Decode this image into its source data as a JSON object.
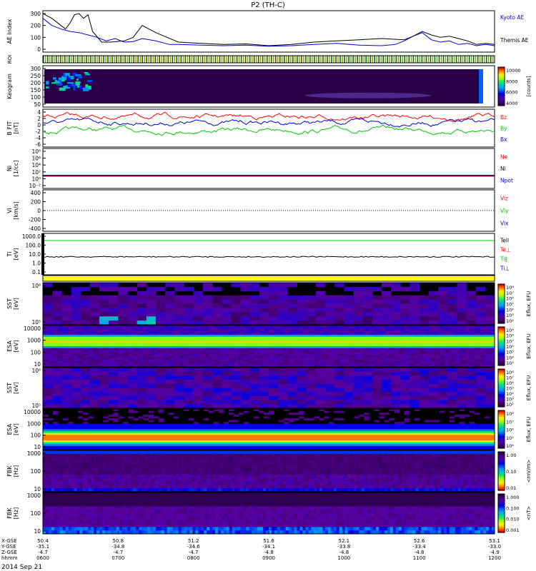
{
  "title": "P2 (TH-C)",
  "date_label": "2014 Sep 21",
  "colors": {
    "red": "#ff0000",
    "green": "#00c800",
    "blue": "#0000dc",
    "black": "#000000",
    "yellow": "#ffff00"
  },
  "chart_data": [
    {
      "type": "line",
      "panel": "ae",
      "ylabel": "AE Index",
      "ylim": [
        0,
        300
      ],
      "yticks": [
        "0",
        "100",
        "200",
        "300"
      ],
      "legend": [
        "Kyoto AE",
        "Themis AE"
      ],
      "series": [
        {
          "name": "Kyoto AE",
          "color": "#0000dc",
          "x": [
            0,
            0.02,
            0.04,
            0.06,
            0.08,
            0.1,
            0.12,
            0.14,
            0.16,
            0.18,
            0.2,
            0.22,
            0.25,
            0.28,
            0.3,
            0.35,
            0.4,
            0.45,
            0.5,
            0.55,
            0.6,
            0.65,
            0.7,
            0.75,
            0.78,
            0.8,
            0.82,
            0.84,
            0.86,
            0.88,
            0.9,
            0.92,
            0.94,
            0.96,
            0.98,
            1
          ],
          "y": [
            260,
            200,
            170,
            150,
            140,
            120,
            100,
            70,
            90,
            60,
            65,
            90,
            70,
            40,
            40,
            35,
            30,
            35,
            25,
            30,
            40,
            50,
            35,
            30,
            40,
            70,
            110,
            140,
            80,
            60,
            70,
            40,
            50,
            30,
            40,
            30
          ]
        },
        {
          "name": "Themis AE",
          "color": "#000000",
          "x": [
            0,
            0.01,
            0.02,
            0.04,
            0.05,
            0.06,
            0.07,
            0.08,
            0.09,
            0.1,
            0.11,
            0.13,
            0.15,
            0.18,
            0.2,
            0.22,
            0.25,
            0.3,
            0.35,
            0.4,
            0.45,
            0.5,
            0.55,
            0.6,
            0.65,
            0.7,
            0.75,
            0.8,
            0.82,
            0.84,
            0.86,
            0.88,
            0.9,
            0.92,
            0.94,
            0.96,
            0.98,
            1
          ],
          "y": [
            300,
            280,
            260,
            200,
            170,
            220,
            290,
            300,
            260,
            290,
            150,
            60,
            60,
            70,
            100,
            200,
            140,
            60,
            50,
            40,
            45,
            30,
            40,
            60,
            70,
            80,
            90,
            80,
            110,
            150,
            120,
            100,
            110,
            90,
            70,
            40,
            50,
            40
          ]
        }
      ]
    },
    {
      "type": "heatmap",
      "panel": "roi",
      "ylabel": "ROI"
    },
    {
      "type": "heatmap",
      "panel": "keogram",
      "ylabel": "Keogram",
      "ylim": [
        0,
        300
      ],
      "yticks": [
        "50",
        "100",
        "150",
        "200",
        "250",
        "300"
      ],
      "colorbar": {
        "label": "[counts]",
        "ticks": [
          "10000",
          "8000",
          "6000",
          "4000"
        ]
      }
    },
    {
      "type": "line",
      "panel": "bfield",
      "ylabel": "B FIT",
      "unit": "[nT]",
      "yticks": [
        "4",
        "2",
        "0",
        "-2",
        "-4",
        "-6"
      ],
      "legend": [
        "Bz",
        "By",
        "Bx"
      ]
    },
    {
      "type": "line",
      "panel": "density",
      "ylabel": "Ni",
      "unit": "[1/cc]",
      "yticks": [
        "10⁸",
        "10⁶",
        "10⁴",
        "10²",
        "10⁰",
        "10⁻²"
      ],
      "legend": [
        "Ne",
        "Ni",
        "Npot"
      ]
    },
    {
      "type": "line",
      "panel": "velocity",
      "ylabel": "Vi",
      "unit": "[km/s]",
      "yticks": [
        "400",
        "200",
        "0",
        "-200",
        "-400"
      ],
      "legend": [
        "Viz",
        "Viy",
        "Vix"
      ]
    },
    {
      "type": "line",
      "panel": "temp",
      "ylabel": "Ti",
      "unit": "[eV]",
      "yticks": [
        "1000.0",
        "100.0",
        "10.0",
        "1.0",
        "0.1"
      ],
      "legend": [
        "Tell",
        "Te⊥",
        "Ti∥",
        "Ti⊥"
      ]
    },
    {
      "type": "heatmap",
      "panel": "sst_e",
      "ylabel": "SST",
      "unit": "[eV]",
      "yticks": [
        "10⁶",
        "10⁵"
      ],
      "colorbar": {
        "label": "Eflux, EFU",
        "ticks": [
          "10⁸",
          "10⁷",
          "10⁶",
          "10⁵",
          "10⁴",
          "10³",
          "10²"
        ]
      }
    },
    {
      "type": "heatmap",
      "panel": "esa_e",
      "ylabel": "ESA",
      "unit": "[eV]",
      "yticks": [
        "10000",
        "1000",
        "100",
        "10"
      ],
      "colorbar": {
        "label": "Eflux, EFU",
        "ticks": [
          "10⁹",
          "10⁸",
          "10⁷",
          "10⁶",
          "10⁵",
          "10⁴",
          "10³"
        ]
      }
    },
    {
      "type": "heatmap",
      "panel": "sst_i",
      "ylabel": "SST",
      "unit": "[eV]",
      "yticks": [
        "10⁶",
        "10⁵"
      ],
      "colorbar": {
        "label": "Eflux, EFU",
        "ticks": [
          "10⁸",
          "10⁷",
          "10⁶",
          "10⁵",
          "10⁴",
          "10³",
          "10²"
        ]
      }
    },
    {
      "type": "heatmap",
      "panel": "esa_i",
      "ylabel": "ESA",
      "unit": "[eV]",
      "yticks": [
        "10000",
        "1000",
        "100",
        "10"
      ],
      "colorbar": {
        "label": "Eflux, EFU",
        "ticks": [
          "10⁸",
          "10⁷",
          "10⁶",
          "10⁵",
          "10⁴"
        ]
      }
    },
    {
      "type": "heatmap",
      "panel": "fbk_e",
      "ylabel": "FBK",
      "unit": "[Hz]",
      "yticks": [
        "1000",
        "100",
        "10"
      ],
      "colorbar": {
        "label": "<mV/m>",
        "ticks": [
          "1.00",
          "0.10",
          "0.01"
        ]
      }
    },
    {
      "type": "heatmap",
      "panel": "fbk_b",
      "ylabel": "FBK",
      "unit": "[Hz]",
      "yticks": [
        "1000",
        "100",
        "10"
      ],
      "colorbar": {
        "label": "<nT>",
        "ticks": [
          "1.000",
          "0.100",
          "0.010",
          "0.001"
        ]
      }
    }
  ],
  "xaxis": {
    "row_labels": [
      "X-GSE",
      "Y-GSE",
      "Z-GSE",
      "hhmm"
    ],
    "columns": [
      [
        "50.4",
        "-35.1",
        "-4.7",
        "0600"
      ],
      [
        "50.8",
        "-34.8",
        "-4.7",
        "0700"
      ],
      [
        "51.2",
        "-34.6",
        "-4.7",
        "0800"
      ],
      [
        "51.6",
        "-34.1",
        "-4.8",
        "0900"
      ],
      [
        "52.1",
        "-33.8",
        "-4.8",
        "1000"
      ],
      [
        "52.6",
        "-33.4",
        "-4.8",
        "1100"
      ],
      [
        "53.1",
        "-33.0",
        "-4.9",
        "1200"
      ]
    ]
  }
}
